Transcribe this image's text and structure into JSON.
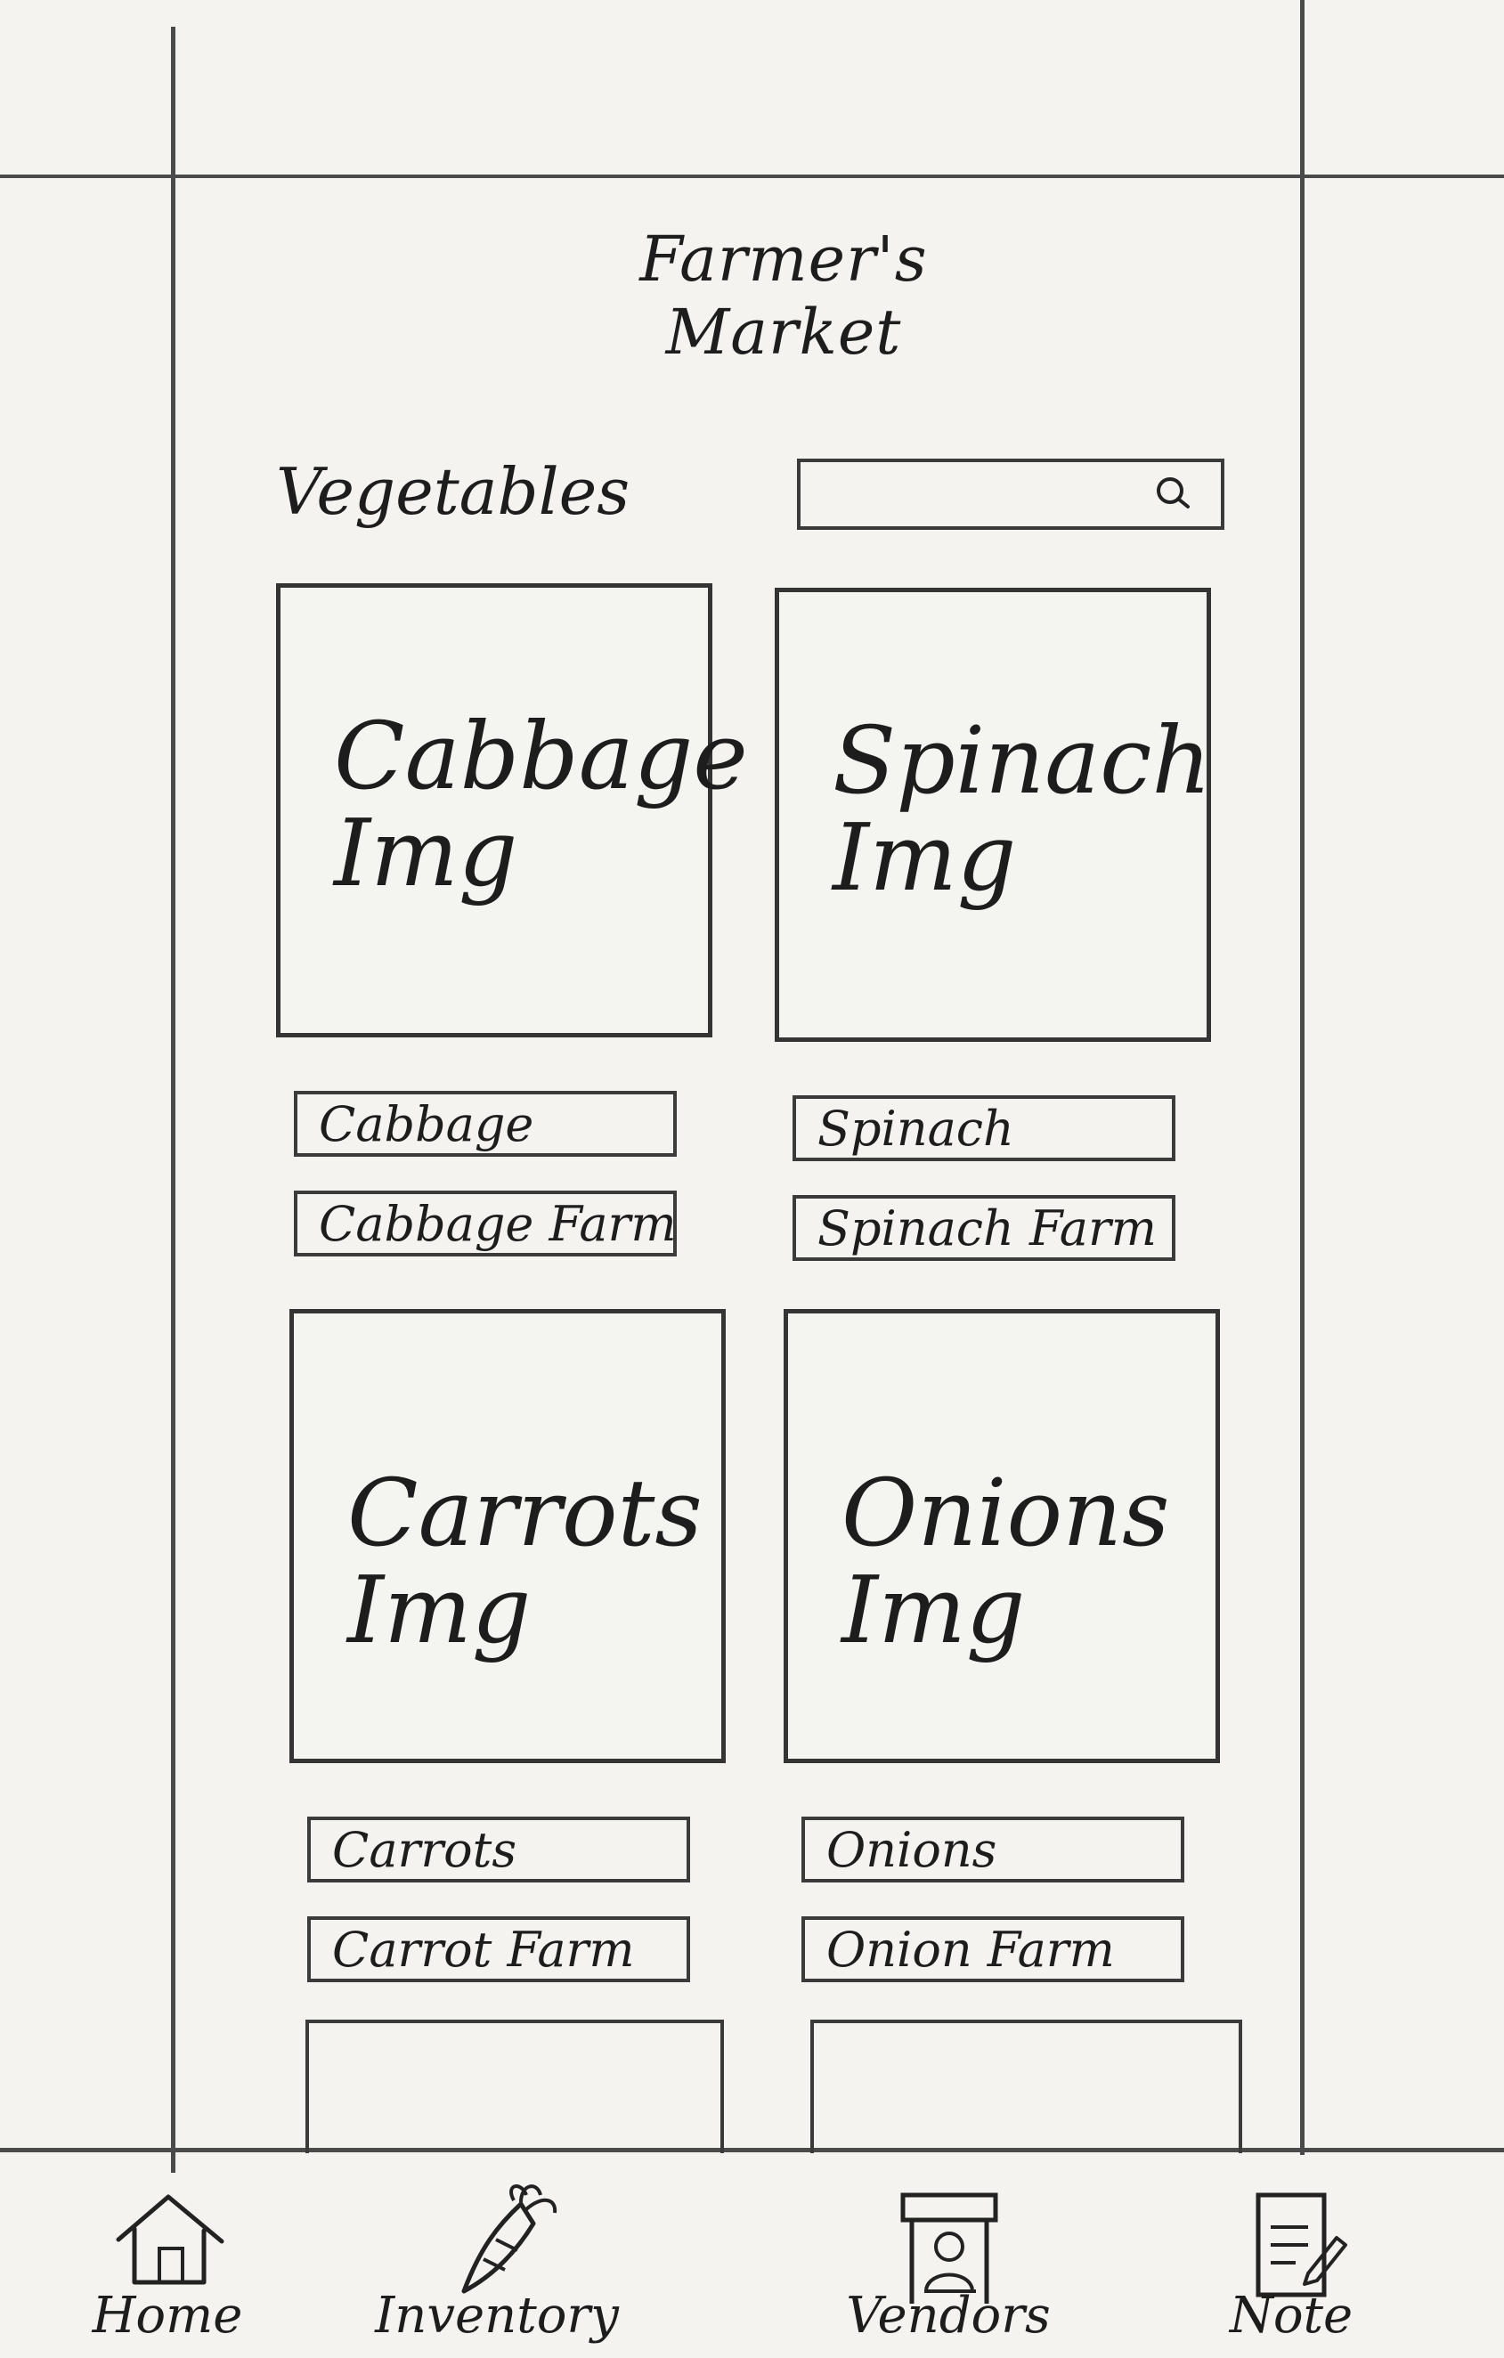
{
  "header": {
    "title": "Farmer's Market"
  },
  "section": {
    "title": "Vegetables"
  },
  "search": {
    "placeholder": "",
    "icon": "search-icon"
  },
  "products": [
    {
      "image_label": "Cabbage\nImg",
      "name": "Cabbage",
      "farm": "Cabbage Farm"
    },
    {
      "image_label": "Spinach\nImg",
      "name": "Spinach",
      "farm": "Spinach Farm"
    },
    {
      "image_label": "Carrots\nImg",
      "name": "Carrots",
      "farm": "Carrot Farm"
    },
    {
      "image_label": "Onions\nImg",
      "name": "Onions",
      "farm": "Onion Farm"
    }
  ],
  "nav": [
    {
      "label": "Home",
      "icon": "home-icon"
    },
    {
      "label": "Inventory",
      "icon": "carrot-icon"
    },
    {
      "label": "Vendors",
      "icon": "vendor-icon"
    },
    {
      "label": "Note",
      "icon": "note-icon"
    }
  ],
  "colors": {
    "paper": "#f4f3ef",
    "ink": "#1d1d1d",
    "line": "#3a3a3a"
  }
}
